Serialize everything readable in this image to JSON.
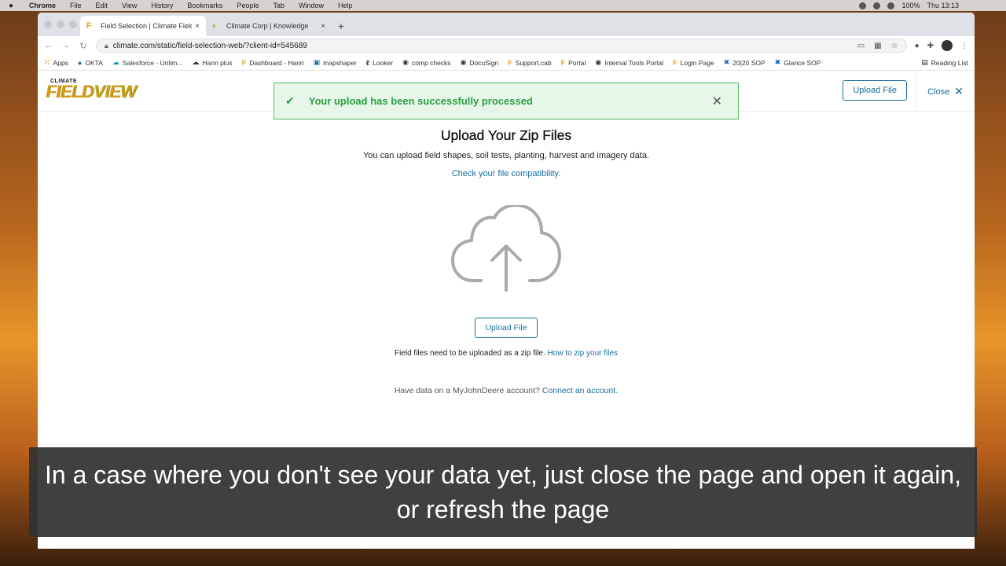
{
  "menubar": {
    "app": "Chrome",
    "items": [
      "File",
      "Edit",
      "View",
      "History",
      "Bookmarks",
      "People",
      "Tab",
      "Window",
      "Help"
    ],
    "battery": "100%",
    "clock": "Thu 13:13"
  },
  "tabs": [
    {
      "label": "Field Selection | Climate FieldV",
      "close": "×"
    },
    {
      "label": "Climate Corp | Knowledge",
      "close": "×"
    }
  ],
  "newtab": "+",
  "omnibox": {
    "url": "climate.com/static/field-selection-web/?client-id=545689"
  },
  "bookmarks": [
    "Apps",
    "OKTA",
    "Salesforce - Unlim...",
    "Hanri plus",
    "Dashboard - Hanri",
    "mapshaper",
    "Looker",
    "comp checks",
    "DocuSign",
    "Support.cab",
    "Portal",
    "Internal Tools Portal",
    "Login Page",
    "20|20 SOP",
    "Glance SOP"
  ],
  "reading_list": "Reading List",
  "header": {
    "logo_small": "CLIMATE",
    "logo_big": "FIELDVIEW",
    "upload_label": "Upload File",
    "close_label": "Close"
  },
  "toast": {
    "message": "Your upload has been successfully processed"
  },
  "main": {
    "title": "Upload Your Zip Files",
    "desc": "You can upload field shapes, soil tests, planting, harvest and imagery data.",
    "compat_link": "Check your file compatibility.",
    "upload_button": "Upload File",
    "note": "Field files need to be uploaded as a zip file.",
    "note_link": "How to zip your files",
    "jd_text": "Have data on a MyJohnDeere account?",
    "jd_link": "Connect an account."
  },
  "caption": "In a case where you don't see your data yet, just close the page and open it again, or refresh the page"
}
